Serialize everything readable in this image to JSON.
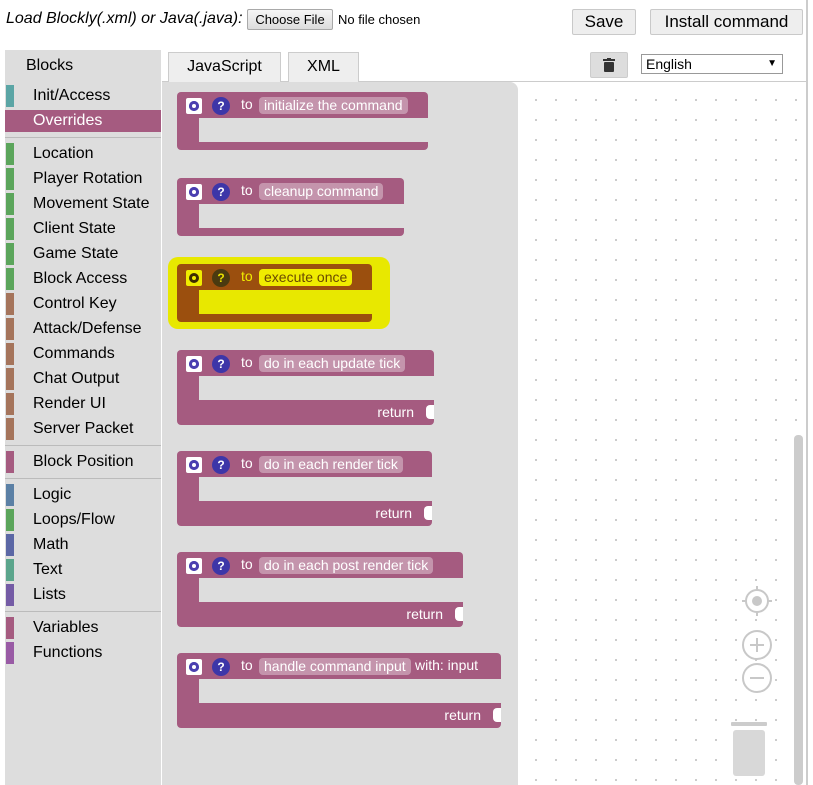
{
  "topbar": {
    "load_label": "Load Blockly(.xml) or Java(.java):",
    "choose_file": "Choose File",
    "no_file": "No file chosen",
    "save": "Save",
    "install": "Install command"
  },
  "tabs": {
    "javascript": "JavaScript",
    "xml": "XML"
  },
  "language": {
    "selected": "English"
  },
  "toolbox": {
    "header": "Blocks",
    "items": [
      {
        "label": "Init/Access",
        "color": "#5ba5a5"
      },
      {
        "label": "Overrides",
        "color": "#a55b80",
        "selected": true
      },
      {
        "label": "Location",
        "color": "#5ba55b"
      },
      {
        "label": "Player Rotation",
        "color": "#5ba55b"
      },
      {
        "label": "Movement State",
        "color": "#5ba55b"
      },
      {
        "label": "Client State",
        "color": "#5ba55b"
      },
      {
        "label": "Game State",
        "color": "#5ba55b"
      },
      {
        "label": "Block Access",
        "color": "#5ba55b"
      },
      {
        "label": "Control Key",
        "color": "#a5745b"
      },
      {
        "label": "Attack/Defense",
        "color": "#a5745b"
      },
      {
        "label": "Commands",
        "color": "#a5745b"
      },
      {
        "label": "Chat Output",
        "color": "#a5745b"
      },
      {
        "label": "Render UI",
        "color": "#a5745b"
      },
      {
        "label": "Server Packet",
        "color": "#a5745b"
      },
      {
        "label": "Block Position",
        "color": "#a55b80"
      },
      {
        "label": "Logic",
        "color": "#5b80a5"
      },
      {
        "label": "Loops/Flow",
        "color": "#5ba55b"
      },
      {
        "label": "Math",
        "color": "#5b67a5"
      },
      {
        "label": "Text",
        "color": "#5ba58c"
      },
      {
        "label": "Lists",
        "color": "#745ba5"
      },
      {
        "label": "Variables",
        "color": "#a55b80"
      },
      {
        "label": "Functions",
        "color": "#995ba5"
      }
    ]
  },
  "blocks": [
    {
      "to": "to",
      "name": "initialize the command"
    },
    {
      "to": "to",
      "name": "cleanup command"
    },
    {
      "to": "to",
      "name": "execute once"
    },
    {
      "to": "to",
      "name": "do in each update tick",
      "return": "return"
    },
    {
      "to": "to",
      "name": "do in each render tick",
      "return": "return"
    },
    {
      "to": "to",
      "name": "do in each post render tick",
      "return": "return"
    },
    {
      "to": "to",
      "name": "handle command input",
      "with": "with: input",
      "return": "return"
    }
  ],
  "icons": {
    "block_gear": "gear-icon",
    "block_help": "help-icon",
    "help_glyph": "?",
    "delete": "trash-icon"
  },
  "colors": {
    "procedure_block": "#a55b80",
    "highlight": "#e8e800",
    "highlighted_block": "#9b4f0e"
  }
}
